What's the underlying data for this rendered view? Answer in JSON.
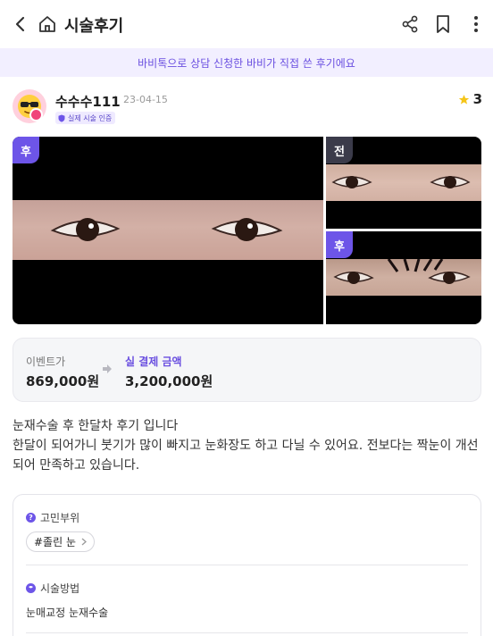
{
  "header": {
    "title": "시술후기"
  },
  "banner": {
    "text": "바비톡으로 상담 신청한 바비가 직접 쓴 후기에요"
  },
  "review": {
    "username": "수수수111",
    "date": "23-04-15",
    "cert_badge": "실제 시술 인증",
    "rating": "3",
    "photo_tags": {
      "main": "후",
      "top": "전",
      "bottom": "후"
    },
    "price": {
      "event_label": "이벤트가",
      "event_price": "869,000원",
      "real_label": "실 결제 금액",
      "real_price": "3,200,000원"
    },
    "text_line1": "눈재수술 후 한달차 후기 입니다",
    "text_line2": "한달이 되어가니 붓기가 많이 빠지고 눈화장도 하고 다닐 수 있어요. 전보다는 짝눈이 개선되어 만족하고 있습니다.",
    "concern": {
      "label": "고민부위",
      "chip": "#졸린 눈"
    },
    "method": {
      "label": "시술방법",
      "value": "눈매교정 눈재수술"
    }
  },
  "colors": {
    "accent": "#6d55e8",
    "banner_bg": "#f2efff",
    "star": "#f5c518"
  }
}
